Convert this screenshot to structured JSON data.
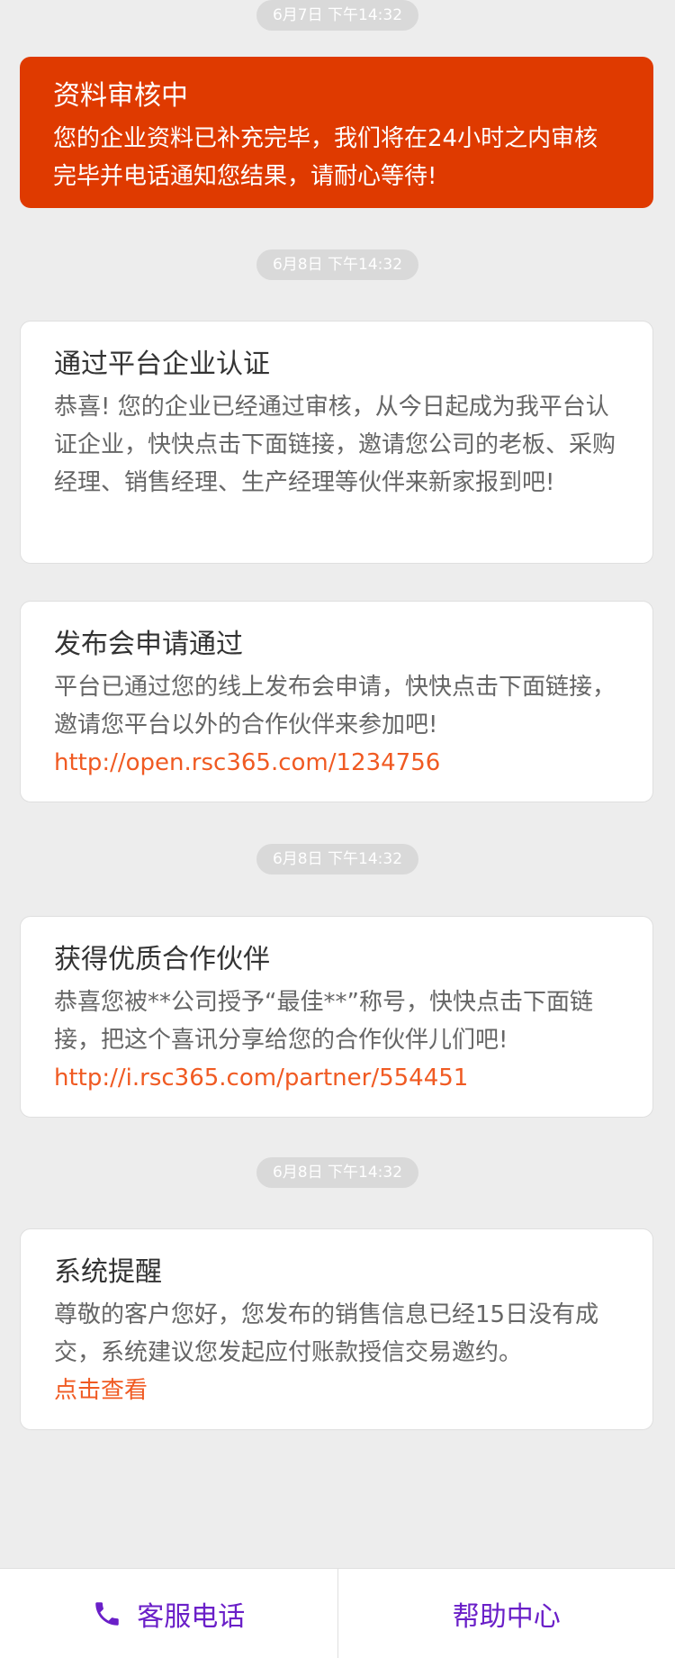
{
  "timestamps": [
    "6月7日 下午14:32",
    "6月8日 下午14:32",
    "6月8日 下午14:32",
    "6月8日 下午14:32"
  ],
  "messages": [
    {
      "title": "资料审核中",
      "body": "您的企业资料已补充完毕，我们将在24小时之内审核完毕并电话通知您结果，请耐心等待!",
      "link": ""
    },
    {
      "title": "通过平台企业认证",
      "body": "恭喜! 您的企业已经通过审核，从今日起成为我平台认证企业，快快点击下面链接，邀请您公司的老板、采购经理、销售经理、生产经理等伙伴来新家报到吧!",
      "link": ""
    },
    {
      "title": "发布会申请通过",
      "body": "平台已通过您的线上发布会申请，快快点击下面链接，邀请您平台以外的合作伙伴来参加吧!",
      "link": "http://open.rsc365.com/1234756"
    },
    {
      "title": "获得优质合作伙伴",
      "body": "恭喜您被**公司授予“最佳**”称号，快快点击下面链接，把这个喜讯分享给您的合作伙伴儿们吧!",
      "link": "http://i.rsc365.com/partner/554451"
    },
    {
      "title": "系统提醒",
      "body": "尊敬的客户您好，您发布的销售信息已经15日没有成交，系统建议您发起应付账款授信交易邀约。",
      "link": "点击查看"
    }
  ],
  "bottom_bar": {
    "customer_service": "客服电话",
    "help_center": "帮助中心",
    "phone_icon": "phone-icon",
    "accent_color": "#6a1fc8"
  },
  "colors": {
    "alert_background": "#df3a00",
    "link": "#f05a22",
    "page_background": "#ededed"
  }
}
